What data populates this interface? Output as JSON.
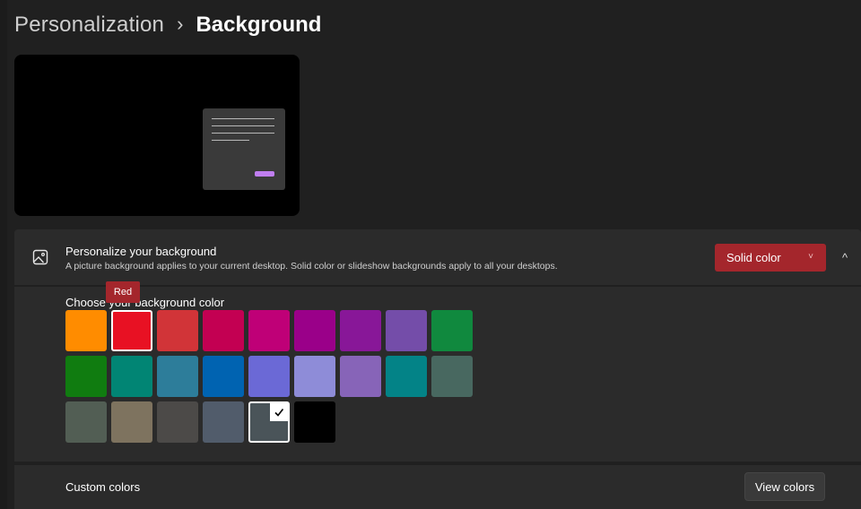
{
  "breadcrumb": {
    "parent": "Personalization",
    "separator": "›",
    "current": "Background"
  },
  "background_card": {
    "icon": "image-icon",
    "title": "Personalize your background",
    "subtitle": "A picture background applies to your current desktop. Solid color or slideshow backgrounds apply to all your desktops.",
    "dropdown_value": "Solid color",
    "dropdown_chevron": "˅",
    "collapse_glyph": "^"
  },
  "color_picker": {
    "label": "Choose your background color",
    "tooltip": "Red",
    "selected_index": 22,
    "hovered_index": 1,
    "colors": [
      "#ff8c00",
      "#e81123",
      "#d13438",
      "#c30052",
      "#bf0077",
      "#9a0089",
      "#881798",
      "#744da9",
      "#10893e",
      "#107c10",
      "#018574",
      "#2d7d9a",
      "#0063b1",
      "#6b69d6",
      "#8e8cd8",
      "#8764b8",
      "#038387",
      "#486860",
      "#525e54",
      "#7e735f",
      "#4c4a48",
      "#515c6b",
      "#4a5459",
      "#000000"
    ]
  },
  "custom_colors": {
    "label": "Custom colors",
    "button": "View colors"
  }
}
